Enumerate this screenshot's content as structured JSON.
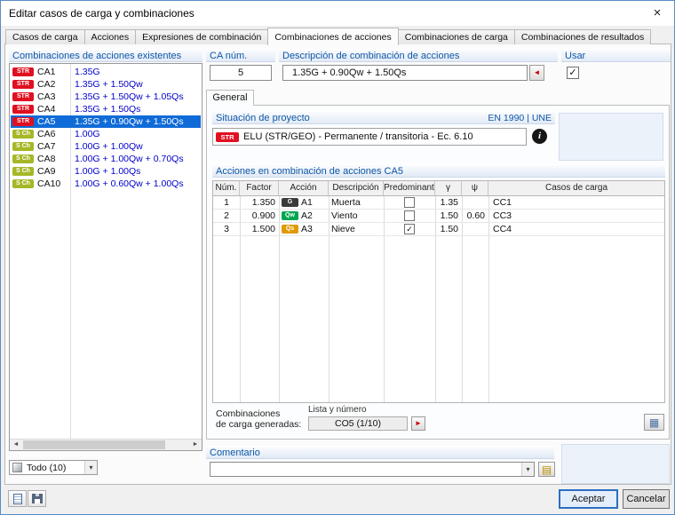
{
  "window": {
    "title": "Editar casos de carga y combinaciones"
  },
  "icons": {
    "close": "×",
    "scroll_left": "◄",
    "scroll_right": "►",
    "arrow_left_red": "◄",
    "arrow_right_red": "►",
    "dropdown": "▾",
    "info": "i",
    "grid": "▦",
    "note": "▤"
  },
  "colors": {
    "selection": "#0f6bd7",
    "header_text": "#0d56a6",
    "formula_text": "#0000cd",
    "badge_str": "#e01020",
    "badge_sch": "#a6b727",
    "badge_g": "#3a3a3a",
    "badge_qw": "#00a550",
    "badge_qs": "#e09a00",
    "accent_red": "#cc0000"
  },
  "tabs": [
    {
      "label": "Casos de carga"
    },
    {
      "label": "Acciones"
    },
    {
      "label": "Expresiones de combinación"
    },
    {
      "label": "Combinaciones de acciones"
    },
    {
      "label": "Combinaciones de carga"
    },
    {
      "label": "Combinaciones de resultados"
    }
  ],
  "left_panel": {
    "header": "Combinaciones de acciones existentes",
    "items": [
      {
        "badge": "STR",
        "name": "CA1",
        "formula": "1.35G"
      },
      {
        "badge": "STR",
        "name": "CA2",
        "formula": "1.35G + 1.50Qw"
      },
      {
        "badge": "STR",
        "name": "CA3",
        "formula": "1.35G + 1.50Qw + 1.05Qs"
      },
      {
        "badge": "STR",
        "name": "CA4",
        "formula": "1.35G + 1.50Qs"
      },
      {
        "badge": "STR",
        "name": "CA5",
        "formula": "1.35G + 0.90Qw + 1.50Qs"
      },
      {
        "badge": "S Ch",
        "name": "CA6",
        "formula": "1.00G"
      },
      {
        "badge": "S Ch",
        "name": "CA7",
        "formula": "1.00G + 1.00Qw"
      },
      {
        "badge": "S Ch",
        "name": "CA8",
        "formula": "1.00G + 1.00Qw + 0.70Qs"
      },
      {
        "badge": "S Ch",
        "name": "CA9",
        "formula": "1.00G + 1.00Qs"
      },
      {
        "badge": "S Ch",
        "name": "CA10",
        "formula": "1.00G + 0.60Qw + 1.00Qs"
      }
    ],
    "filter_value": "Todo (10)"
  },
  "fields": {
    "ca_num_label": "CA núm.",
    "ca_num_value": "5",
    "desc_label": "Descripción de combinación de acciones",
    "desc_value": "1.35G + 0.90Qw + 1.50Qs",
    "usar_label": "Usar",
    "usar_check": "✓"
  },
  "general": {
    "tab_label": "General",
    "situacion_header": "Situación de proyecto",
    "situacion_code": "EN 1990 | UNE",
    "situacion_badge": "STR",
    "situacion_value": "ELU (STR/GEO) - Permanente / transitoria - Ec. 6.10",
    "acciones_header": "Acciones en combinación de acciones CA5",
    "table": {
      "columns": [
        "Núm.",
        "Factor",
        "Acción",
        "Descripción",
        "Predominant",
        "γ",
        "ψ",
        "Casos de carga"
      ],
      "rows": [
        {
          "num": "1",
          "factor": "1.350",
          "badge": "G",
          "accion": "A1",
          "desc": "Muerta",
          "predominant": "",
          "gamma": "1.35",
          "psi": "",
          "casos": "CC1"
        },
        {
          "num": "2",
          "factor": "0.900",
          "badge": "Qw",
          "accion": "A2",
          "desc": "Viento",
          "predominant": "",
          "gamma": "1.50",
          "psi": "0.60",
          "casos": "CC3"
        },
        {
          "num": "3",
          "factor": "1.500",
          "badge": "Qs",
          "accion": "A3",
          "desc": "Nieve",
          "predominant": "✓",
          "gamma": "1.50",
          "psi": "",
          "casos": "CC4"
        }
      ]
    },
    "generadas_label_1": "Combinaciones",
    "generadas_label_2": "de carga generadas:",
    "generadas_sublabel": "Lista y número",
    "generadas_value": "CO5 (1/10)"
  },
  "comentario": {
    "header": "Comentario",
    "value": ""
  },
  "buttons": {
    "accept": "Aceptar",
    "cancel": "Cancelar"
  }
}
